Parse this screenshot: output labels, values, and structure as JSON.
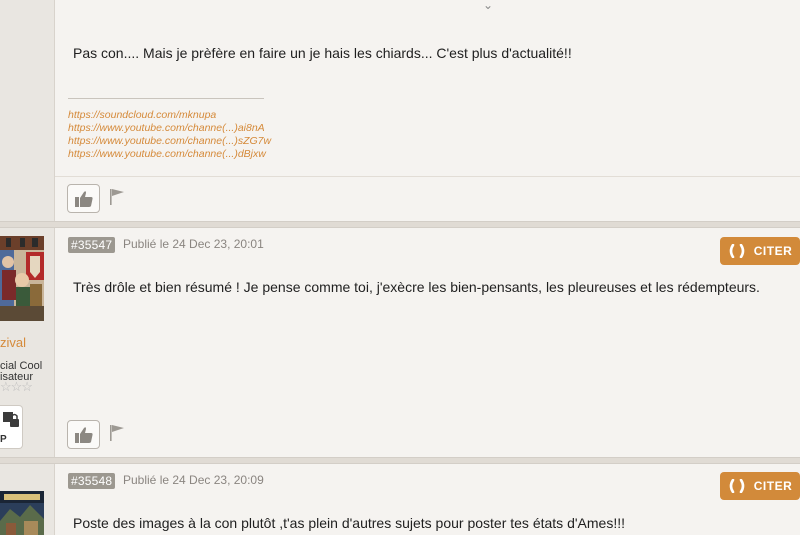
{
  "post1": {
    "text": "Pas con.... Mais je prèfère en faire un je hais les chiards... C'est plus d'actualité!!",
    "signature_links": [
      "https://soundcloud.com/mknupa",
      "https://www.youtube.com/channe(...)ai8nA",
      "https://www.youtube.com/channe(...)sZG7w",
      "https://www.youtube.com/channe(...)dBjxw"
    ]
  },
  "post2": {
    "id": "#35547",
    "date": "Publié le 24 Dec 23, 20:01",
    "citer_label": "CITER",
    "text": "Très drôle et bien résumé ! Je pense comme toi, j'exècre les bien-pensants, les pleureuses et les rédempteurs.",
    "author": {
      "name": "zival",
      "rank_line1": "cial Cool",
      "rank_line2": "isateur",
      "stars": "☆☆☆",
      "badge": "P"
    }
  },
  "post3": {
    "id": "#35548",
    "date": "Publié le 24 Dec 23, 20:09",
    "citer_label": "CITER",
    "text": "Poste des images à la con plutôt ,t'as plein d'autres sujets pour poster tes états d'Ames!!!"
  },
  "icons": {
    "like": "thumbs-up-icon",
    "report": "flag-icon",
    "quote": "quote-icon",
    "expand": "chevron-down-icon"
  },
  "colors": {
    "accent": "#d28a3a",
    "link": "#d58a3a",
    "post_id_bg": "#9c9890"
  }
}
